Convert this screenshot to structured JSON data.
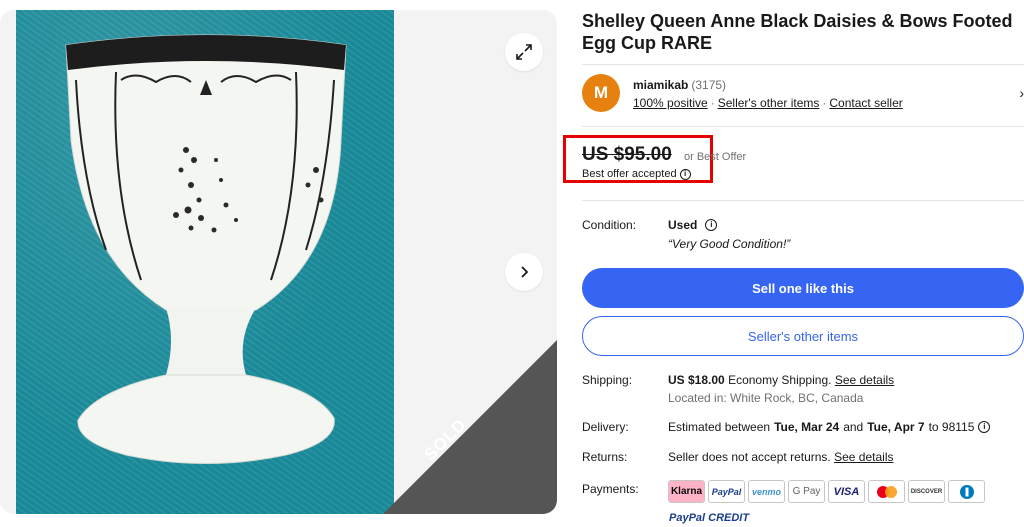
{
  "listing": {
    "title": "Shelley Queen Anne Black Daisies & Bows Footed Egg Cup RARE"
  },
  "gallery": {
    "sold_label": "SOLD",
    "expand_icon": "expand-icon",
    "next_icon": "chevron-right-icon"
  },
  "seller": {
    "avatar_letter": "M",
    "name": "miamikab",
    "feedback_count": "(3175)",
    "positive": "100% positive",
    "other_items_link": "Seller's other items",
    "contact": "Contact seller",
    "chevron": "›"
  },
  "price": {
    "amount": "US $95.00",
    "or_best_offer": "or Best Offer",
    "best_offer_accepted": "Best offer accepted",
    "info_glyph": "i"
  },
  "condition": {
    "label": "Condition:",
    "value": "Used",
    "note": "“Very Good Condition!”",
    "info_glyph": "i"
  },
  "actions": {
    "sell_one": "Sell one like this",
    "sellers_other_items": "Seller's other items"
  },
  "shipping": {
    "label": "Shipping:",
    "amount": "US $18.00",
    "method": "Economy Shipping.",
    "see_details": "See details",
    "location": "Located in: White Rock, BC, Canada"
  },
  "delivery": {
    "label": "Delivery:",
    "prefix": "Estimated between",
    "start": "Tue, Mar 24",
    "and": "and",
    "end": "Tue, Apr 7",
    "to": "to 98115",
    "info_glyph": "i"
  },
  "returns": {
    "label": "Returns:",
    "text": "Seller does not accept returns.",
    "see_details": "See details"
  },
  "payments": {
    "label": "Payments:",
    "methods": [
      "Klarna",
      "PayPal",
      "venmo",
      "G Pay",
      "VISA",
      "",
      "DISCOVER",
      ""
    ],
    "paypal_credit": "PayPal CREDIT"
  },
  "colors": {
    "primary_blue": "#3665f3",
    "highlight_red": "#e60000",
    "avatar_orange": "#e6800e",
    "sold_band": "#555555"
  }
}
